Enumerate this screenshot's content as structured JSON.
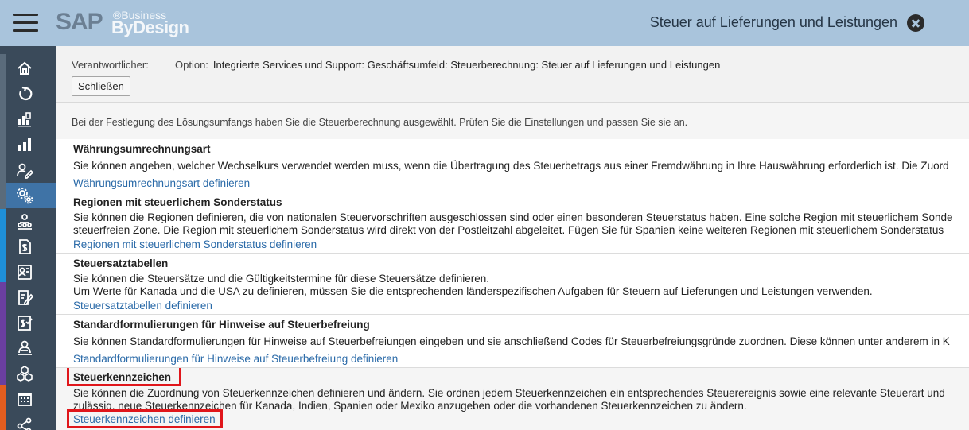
{
  "header": {
    "logo_sap": "SAP",
    "logo_business": "®Business",
    "logo_bydesign": "ByDesign",
    "title": "Steuer auf Lieferungen und Leistungen"
  },
  "sidebar": {
    "items": [
      {
        "icon": "home-icon"
      },
      {
        "icon": "refresh-icon"
      },
      {
        "icon": "dashboard-icon"
      },
      {
        "icon": "bar-chart-icon"
      },
      {
        "icon": "edit-user-icon"
      },
      {
        "icon": "settings-gears-icon",
        "active": true
      },
      {
        "icon": "team-icon"
      },
      {
        "icon": "document-money-icon"
      },
      {
        "icon": "contact-card-icon"
      },
      {
        "icon": "form-edit-icon"
      },
      {
        "icon": "money-checklist-icon"
      },
      {
        "icon": "support-agent-icon"
      },
      {
        "icon": "cubes-icon"
      },
      {
        "icon": "calendar-grid-icon"
      },
      {
        "icon": "share-network-icon"
      }
    ],
    "accent_colors": [
      "#5a6b7b",
      "#1e8fd8",
      "#6b3fa0",
      "#e35d1f"
    ]
  },
  "top": {
    "responsible_label": "Verantwortlicher:",
    "option_label": "Option:",
    "option_value": "Integrierte Services und Support: Geschäftsumfeld: Steuerberechnung: Steuer auf Lieferungen und Leistungen",
    "close_button": "Schließen"
  },
  "intro": "Bei der Festlegung des Lösungsumfangs haben Sie die Steuerberechnung ausgewählt. Prüfen Sie die Einstellungen und passen Sie sie an.",
  "sections": [
    {
      "title": "Währungsumrechnungsart",
      "lines": [
        "Sie können angeben, welcher Wechselkurs verwendet werden muss, wenn die Übertragung des Steuerbetrags aus einer Fremdwährung in Ihre Hauswährung erforderlich ist. Die Zuord"
      ],
      "link": "Währungsumrechnungsart definieren"
    },
    {
      "title": "Regionen mit steuerlichem Sonderstatus",
      "lines": [
        "Sie können die Regionen definieren, die von nationalen Steuervorschriften ausgeschlossen sind oder einen besonderen Steuerstatus haben. Eine solche Region mit steuerlichem Sonde",
        "steuerfreien Zone. Die Region mit steuerlichem Sonderstatus wird direkt von der Postleitzahl abgeleitet. Fügen Sie für Spanien keine weiteren Regionen mit steuerlichem Sonderstatus"
      ],
      "link": "Regionen mit steuerlichem Sonderstatus definieren"
    },
    {
      "title": "Steuersatztabellen",
      "lines": [
        "Sie können die Steuersätze und die Gültigkeitstermine für diese Steuersätze definieren.",
        "Um Werte für Kanada und die USA zu definieren, müssen Sie die entsprechenden länderspezifischen Aufgaben für Steuern auf Lieferungen und Leistungen verwenden."
      ],
      "link": "Steuersatztabellen definieren"
    },
    {
      "title": "Standardformulierungen für Hinweise auf Steuerbefreiung",
      "lines": [
        "Sie können Standardformulierungen für Hinweise auf Steuerbefreiungen eingeben und sie anschließend Codes für Steuerbefreiungsgründe zuordnen. Diese können unter anderem in K"
      ],
      "link": "Standardformulierungen für Hinweise auf Steuerbefreiung definieren"
    },
    {
      "title": "Steuerkennzeichen",
      "lines": [
        "Sie können die Zuordnung von Steuerkennzeichen definieren und ändern. Sie ordnen jedem Steuerkennzeichen ein entsprechendes Steuerereignis sowie eine relevante Steuerart und",
        "zulässig, neue Steuerkennzeichen für Kanada, Indien, Spanien oder Mexiko anzugeben oder die vorhandenen Steuerkennzeichen zu ändern."
      ],
      "link": "Steuerkennzeichen definieren"
    }
  ],
  "colors": {
    "header_bg": "#a9c4dc",
    "sidebar_bg": "#3a4a5a",
    "sidebar_active": "#3f73a6",
    "link": "#2a6aa8",
    "highlight": "#e0161b"
  }
}
